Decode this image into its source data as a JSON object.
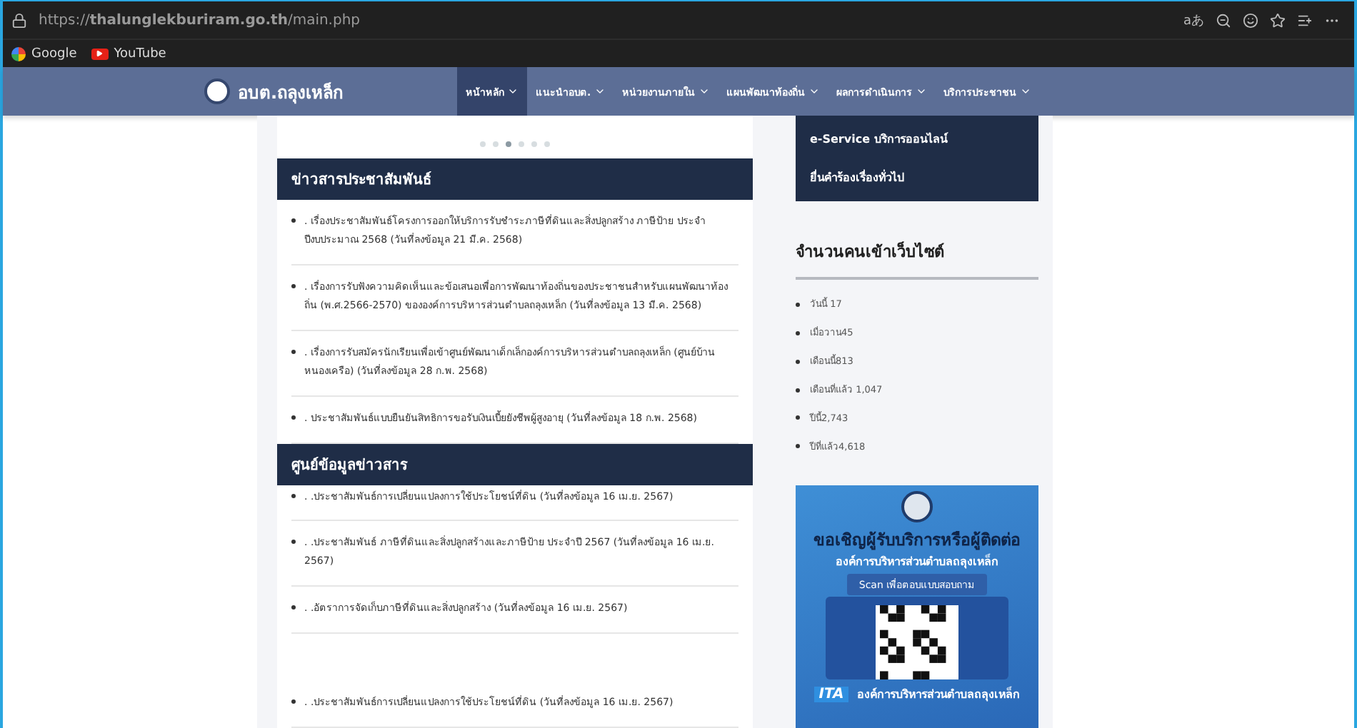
{
  "browser": {
    "url": "https://**thalunglekburiram.go.th**/main.php",
    "reader_label": "aあ",
    "bookmarks": [
      {
        "label": "Google",
        "kind": "google"
      },
      {
        "label": "YouTube",
        "kind": "youtube"
      }
    ]
  },
  "site_nav": {
    "site_name": "อบต.ถลุงเหล็ก",
    "items": [
      {
        "label": "หน้าหลัก",
        "selected": true
      },
      {
        "label": "แนะนำอบต.",
        "selected": false
      },
      {
        "label": "หน่วยงานภายใน",
        "selected": false
      },
      {
        "label": "แผนพัฒนาท้องถิ่น",
        "selected": false
      },
      {
        "label": "ผลการดำเนินการ",
        "selected": false
      },
      {
        "label": "บริการประชาชน",
        "selected": false
      }
    ]
  },
  "carousel": {
    "dots": [
      {
        "selected": false
      },
      {
        "selected": false
      },
      {
        "selected": true
      },
      {
        "selected": false
      },
      {
        "selected": false
      },
      {
        "selected": false
      }
    ]
  },
  "news": {
    "title": "ข่าวสารประชาสัมพันธ์",
    "items": [
      ". เรื่องประชาสัมพันธ์โครงการออกให้บริการรับชำระภาษีที่ดินและสิ่งปลูกสร้าง ภาษีป้าย ประจำปีงบประมาณ 2568 (วันที่ลงข้อมูล 21 มี.ค. 2568)",
      ". เรื่องการรับฟังความคิดเห็นและข้อเสนอเพื่อการพัฒนาท้องถิ่นของประชาชนสำหรับแผนพัฒนาท้องถิ่น (พ.ศ.2566-2570) ขององค์การบริหารส่วนตำบลถลุงเหล็ก (วันที่ลงข้อมูล 13 มี.ค. 2568)",
      ". เรื่องการรับสมัครนักเรียนเพื่อเข้าศูนย์พัฒนาเด็กเล็กองค์การบริหารส่วนตำบลถลุงเหล็ก (ศูนย์บ้านหนองเครือ) (วันที่ลงข้อมูล 28 ก.พ. 2568)",
      ". ประชาสัมพันธ์แบบยืนยันสิทธิการขอรับเงินเบี้ยยังชีพผู้สูงอายุ (วันที่ลงข้อมูล 18 ก.พ. 2568)"
    ]
  },
  "info_center": {
    "title": "ศูนย์ข้อมูลข่าวสาร",
    "items": [
      {
        "text": ". .ประชาสัมพันธ์การเปลี่ยนแปลงการใช้ประโยชน์ที่ดิน (วันที่ลงข้อมูล 16 เม.ย. 2567)",
        "kind": "partial"
      },
      {
        "text": ". .ประชาสัมพันธ์ ภาษีที่ดินและสิ่งปลูกสร้างและภาษีป้าย ประจำปี 2567 (วันที่ลงข้อมูล 16 เม.ย. 2567)",
        "kind": "normal"
      },
      {
        "text": ". .อัตราการจัดเก็บภาษีที่ดินและสิ่งปลูกสร้าง (วันที่ลงข้อมูล 16 เม.ย. 2567)",
        "kind": "normal"
      },
      {
        "text": ". .ประชาสัมพันธ์การเปลี่ยนแปลงการใช้ประโยชน์ที่ดิน (วันที่ลงข้อมูล 16 เม.ย. 2567)",
        "kind": "spaced"
      }
    ]
  },
  "services": {
    "items": [
      "e-Service บริการออนไลน์",
      "ยื่นคำร้องเรื่องทั่วไป"
    ]
  },
  "visitors": {
    "title": "จำนวนคนเข้าเว็บไซต์",
    "items": [
      "วันนี้ 17",
      "เมื่อวาน45",
      "เดือนนี้813",
      "เดือนที่แล้ว 1,047",
      "ปีนี้2,743",
      "ปีที่แล้ว4,618"
    ]
  },
  "banner": {
    "headline": "ขอเชิญผู้รับบริการหรือผู้ติดต่อ",
    "org": "องค์การบริหารส่วนตำบลถลุงเหล็ก",
    "scan_label": "Scan เพื่อตอบแบบสอบถาม",
    "ita_logo": "ITA",
    "footer_org": "องค์การบริหารส่วนตำบลถลุงเหล็ก"
  }
}
